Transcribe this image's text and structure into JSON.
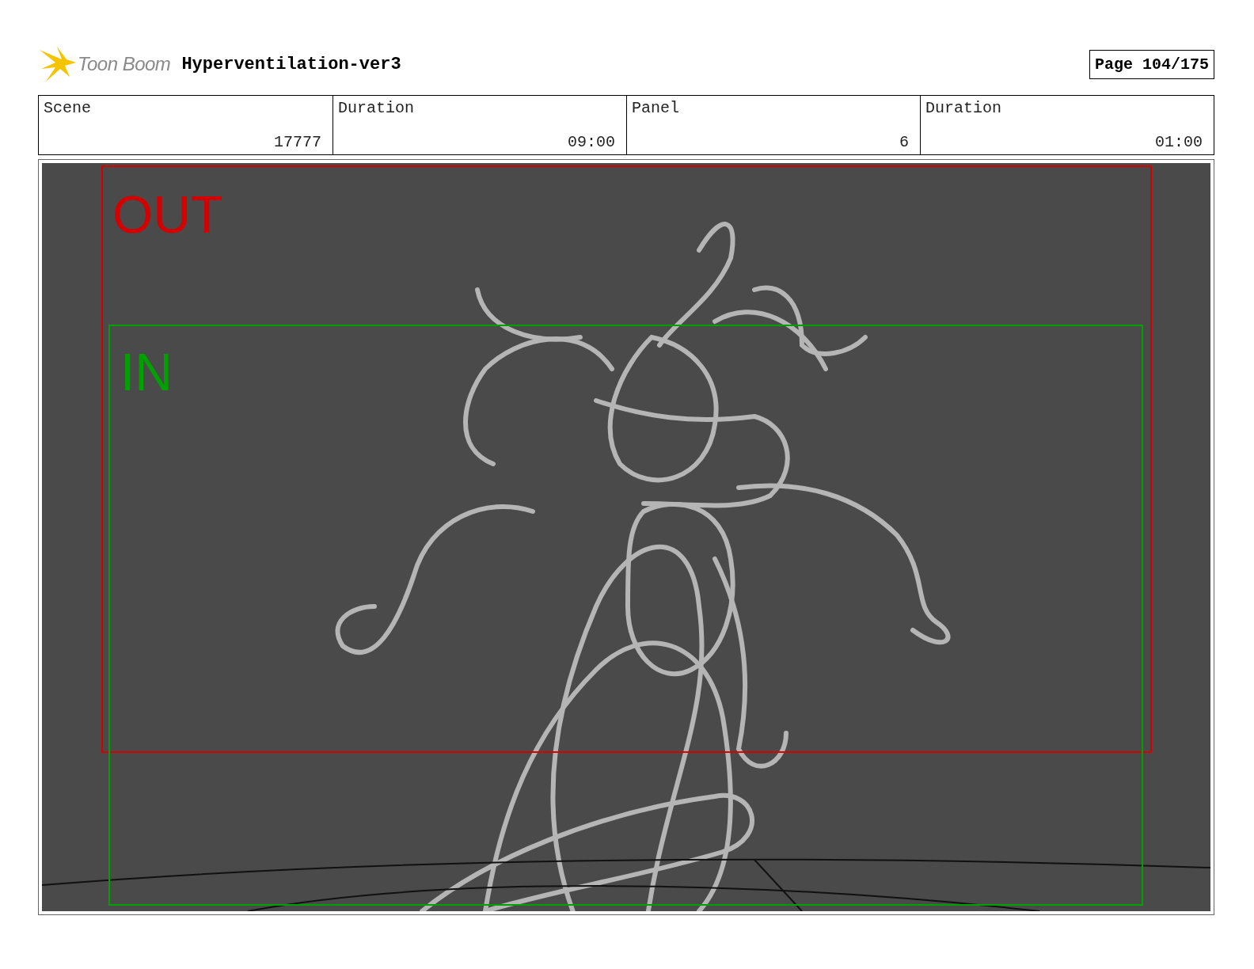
{
  "header": {
    "logo_text": "Toon Boom",
    "title": "Hyperventilation-ver3",
    "page": "Page 104/175"
  },
  "info": [
    {
      "label": "Scene",
      "value": "17777"
    },
    {
      "label": "Duration",
      "value": "09:00"
    },
    {
      "label": "Panel",
      "value": "6"
    },
    {
      "label": "Duration",
      "value": "01:00"
    }
  ],
  "panel": {
    "frames": [
      {
        "label": "OUT",
        "color": "#d40000"
      },
      {
        "label": "IN",
        "color": "#00a000"
      }
    ]
  }
}
